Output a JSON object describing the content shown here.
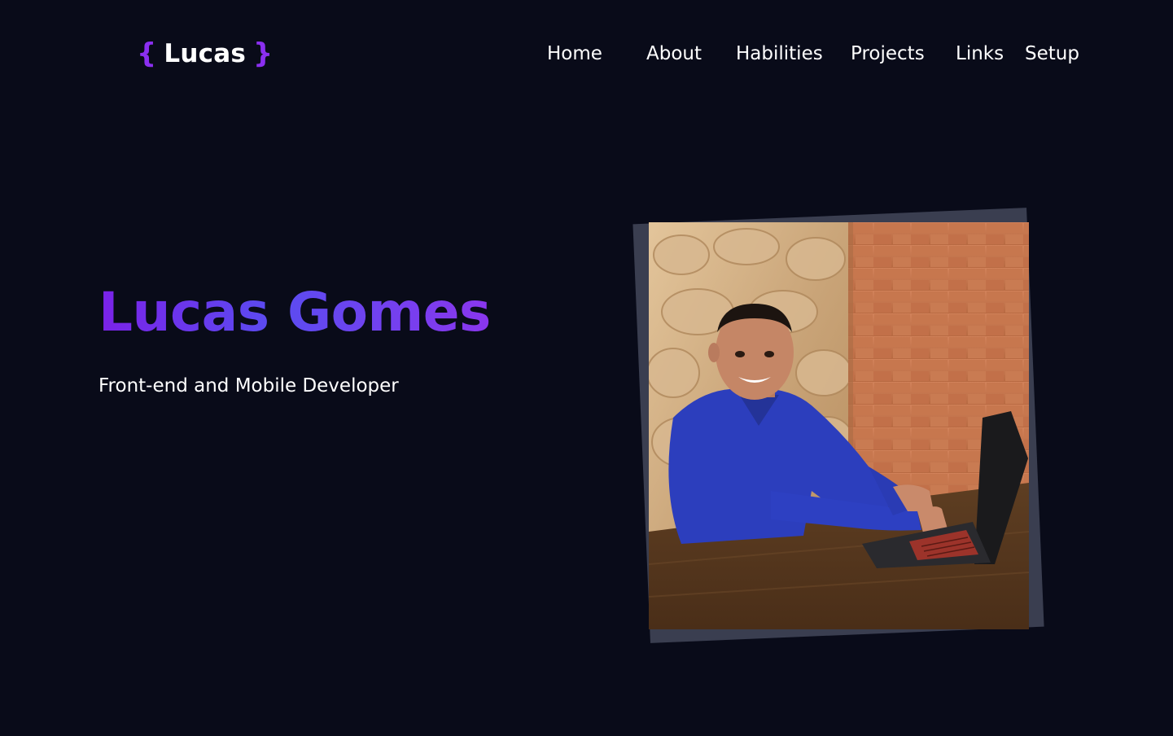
{
  "header": {
    "logo": {
      "open_brace": "{",
      "name": "Lucas",
      "close_brace": "}"
    },
    "nav": [
      {
        "label": "Home"
      },
      {
        "label": "About"
      },
      {
        "label": "Habilities"
      },
      {
        "label": "Projects"
      },
      {
        "label": "Links"
      },
      {
        "label": "Setup"
      }
    ]
  },
  "hero": {
    "title": "Lucas Gomes",
    "subtitle": "Front-end and Mobile Developer"
  },
  "photo": {
    "subject": "profile-photo"
  },
  "colors": {
    "background": "#090b19",
    "accent": "#8b2ff0",
    "gradient_start": "#7b22e8",
    "gradient_end": "#8a36ee",
    "photo_frame": "#3a3e50"
  }
}
